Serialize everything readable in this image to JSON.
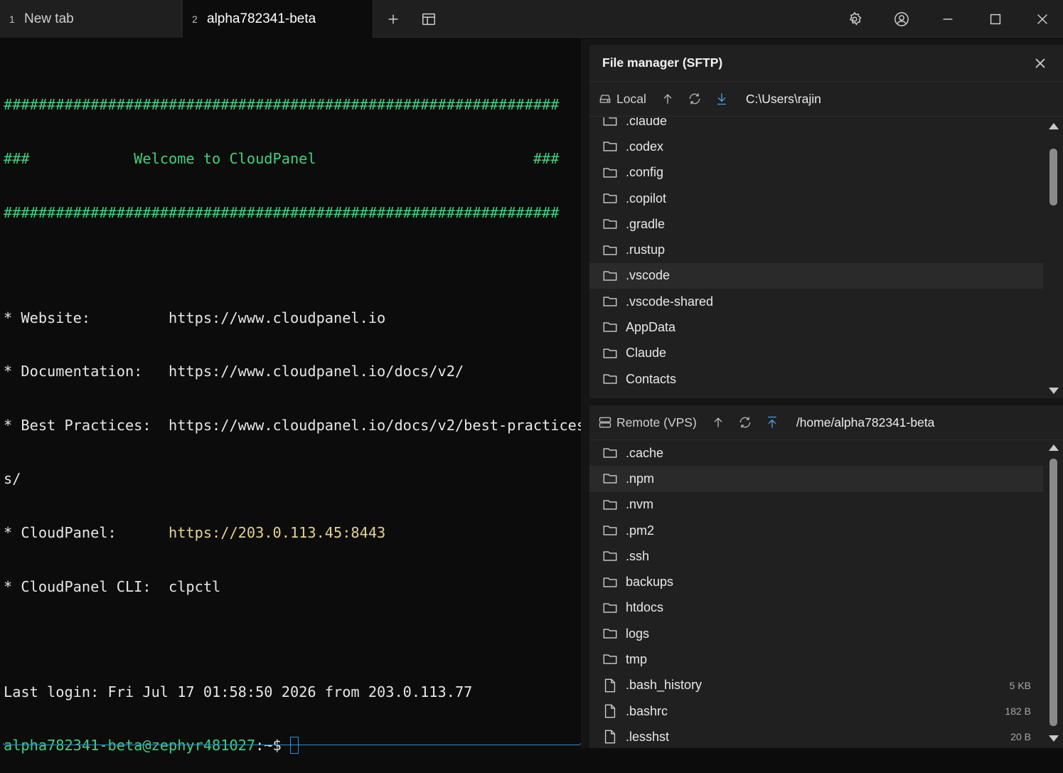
{
  "tabs": [
    {
      "num": "1",
      "label": "New tab"
    },
    {
      "num": "2",
      "label": "alpha782341-beta"
    }
  ],
  "toolbar_icons": [
    "plus-icon",
    "layout-icon",
    "gear-icon",
    "user-circle-icon",
    "minimize-icon",
    "maximize-icon",
    "close-icon"
  ],
  "terminal": {
    "banner_border": "################################################################",
    "banner_welcome": "###            Welcome to CloudPanel                         ###",
    "info": [
      {
        "label": "* Website:         ",
        "value": "https://www.cloudpanel.io"
      },
      {
        "label": "* Documentation:   ",
        "value": "https://www.cloudpanel.io/docs/v2/"
      },
      {
        "label": "* Best Practices:  ",
        "value": "https://www.cloudpanel.io/docs/v2/best-practices"
      },
      {
        "label": "",
        "value": "s/"
      },
      {
        "label": "* CloudPanel:      ",
        "value": "https://203.0.113.45:8443"
      },
      {
        "label": "* CloudPanel CLI:  ",
        "value": "clpctl"
      }
    ],
    "last_login": "Last login: Fri Jul 17 01:58:50 2026 from 203.0.113.77",
    "prompt_user": "alpha782341-beta@zephyr481027",
    "prompt_suffix": ":~$"
  },
  "file_manager": {
    "title": "File manager (SFTP)",
    "local": {
      "label": "Local",
      "path": "C:\\Users\\rajin",
      "items": [
        ".claude",
        ".codex",
        ".config",
        ".copilot",
        ".gradle",
        ".rustup",
        ".vscode",
        ".vscode-shared",
        "AppData",
        "Claude",
        "Contacts"
      ],
      "highlighted": ".vscode"
    },
    "remote": {
      "label": "Remote (VPS)",
      "path": "/home/alpha782341-beta",
      "folders": [
        ".cache",
        ".npm",
        ".nvm",
        ".pm2",
        ".ssh",
        "backups",
        "htdocs",
        "logs",
        "tmp"
      ],
      "files": [
        {
          "name": ".bash_history",
          "size": "5 KB"
        },
        {
          "name": ".bashrc",
          "size": "182 B"
        },
        {
          "name": ".lesshst",
          "size": "20 B"
        }
      ],
      "highlighted": ".npm"
    }
  }
}
